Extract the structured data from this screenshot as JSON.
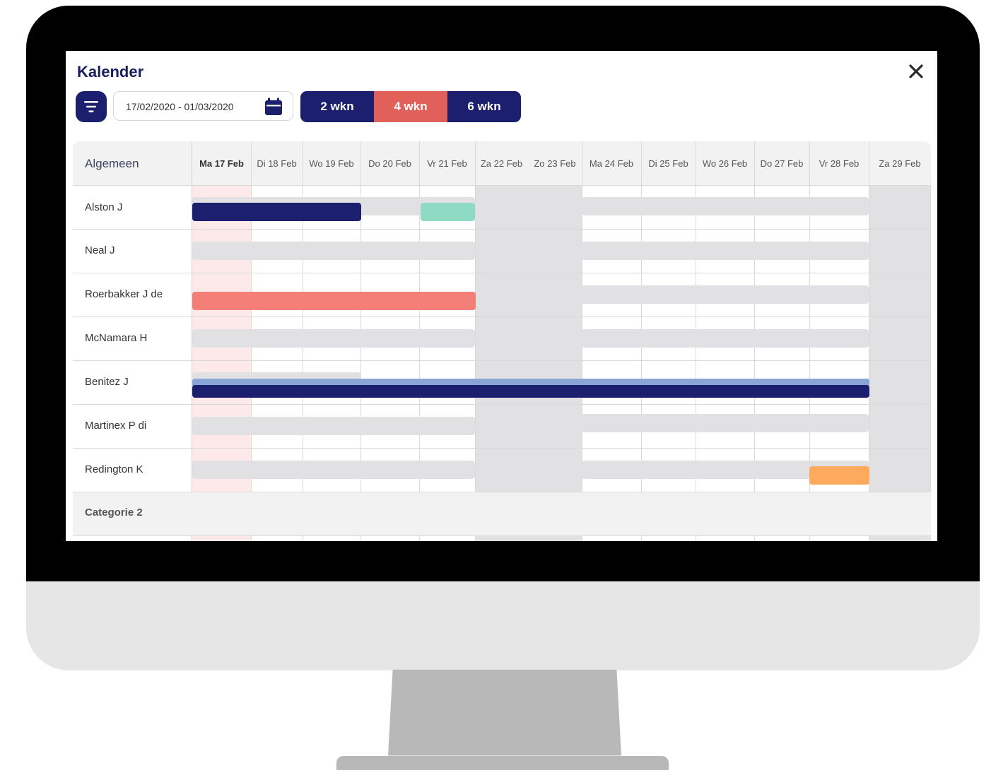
{
  "app": {
    "title": "Kalender"
  },
  "toolbar": {
    "date_range": "17/02/2020 - 01/03/2020",
    "ranges": [
      {
        "label": "2 wkn"
      },
      {
        "label": "4 wkn"
      },
      {
        "label": "6 wkn"
      }
    ],
    "selected_range": "4 wkn"
  },
  "calendar": {
    "group_header": "Algemeen",
    "days": [
      {
        "label": "Ma 17 Feb"
      },
      {
        "label": "Di 18 Feb"
      },
      {
        "label": "Wo 19 Feb"
      },
      {
        "label": "Do 20 Feb"
      },
      {
        "label": "Vr 21 Feb"
      },
      {
        "label": "Za 22 Feb"
      },
      {
        "label": "Zo 23 Feb"
      },
      {
        "label": "Ma 24 Feb"
      },
      {
        "label": "Di 25 Feb"
      },
      {
        "label": "Wo 26 Feb"
      },
      {
        "label": "Do 27 Feb"
      },
      {
        "label": "Vr 28 Feb"
      },
      {
        "label": "Za 29 Feb"
      }
    ],
    "people": [
      {
        "name": "Alston J"
      },
      {
        "name": "Neal J"
      },
      {
        "name": "Roerbakker J de"
      },
      {
        "name": "McNamara H"
      },
      {
        "name": "Benitez J"
      },
      {
        "name": "Martinex P di"
      },
      {
        "name": "Redington K"
      }
    ],
    "category_2": "Categorie 2"
  },
  "colors": {
    "navy": "#1b1f6e",
    "coral": "#f47f79",
    "mint": "#8fdac3",
    "orange": "#fdaa5f",
    "selected_range": "#e2605a",
    "today_column": "#fde9e9",
    "weekend": "#e1e1e3"
  },
  "icons": [
    "filter-icon",
    "calendar-icon",
    "close-icon"
  ]
}
